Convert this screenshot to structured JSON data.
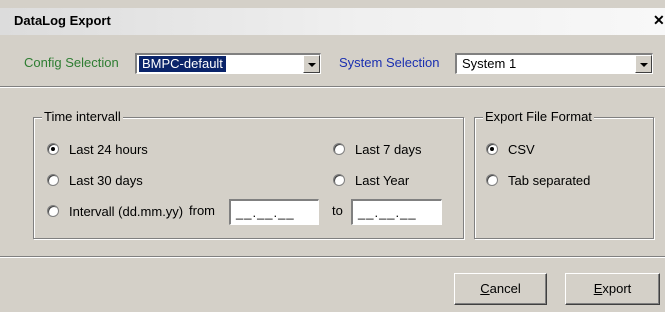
{
  "window": {
    "title": "DataLog Export"
  },
  "config": {
    "label": "Config Selection",
    "label_color": "#2e7d32",
    "value": "BMPC-default"
  },
  "system": {
    "label": "System Selection",
    "label_color": "#1a2fb0",
    "value": "System 1"
  },
  "time_group": {
    "legend": "Time intervall",
    "options": [
      {
        "label": "Last 24 hours",
        "selected": true
      },
      {
        "label": "Last 30 days",
        "selected": false
      },
      {
        "label": "Intervall (dd.mm.yy)",
        "selected": false
      },
      {
        "label": "Last 7 days",
        "selected": false
      },
      {
        "label": "Last Year",
        "selected": false
      }
    ],
    "from_label": "from",
    "to_label": "to",
    "from_mask": "__.__.__",
    "to_mask": "__.__.__"
  },
  "format_group": {
    "legend": "Export File Format",
    "options": [
      {
        "label": "CSV",
        "selected": true
      },
      {
        "label": "Tab separated",
        "selected": false
      }
    ]
  },
  "buttons": {
    "cancel_first": "C",
    "cancel_rest": "ancel",
    "export_first": "E",
    "export_rest": "xport"
  }
}
